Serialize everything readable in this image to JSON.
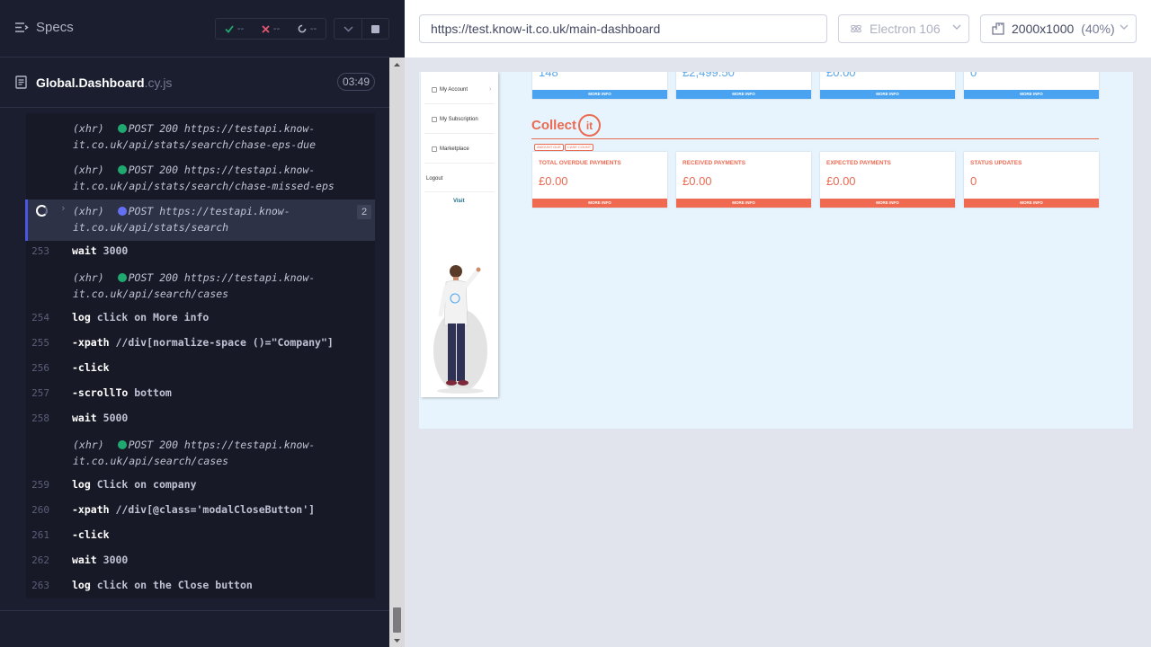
{
  "reporter": {
    "specs_label": "Specs",
    "stats": {
      "passed": "--",
      "failed": "--",
      "pending": "--"
    },
    "spec": {
      "name": "Global.Dashboard",
      "ext": ".cy.js",
      "duration": "03:49"
    },
    "commands": [
      {
        "type": "xhr",
        "tag": "(xhr)",
        "status_color": "#1fa971",
        "text": "POST 200 https://testapi.know-",
        "text2": "it.co.uk/api/stats/search/chase-eps-due"
      },
      {
        "type": "xhr",
        "tag": "(xhr)",
        "status_color": "#1fa971",
        "text": "POST 200 https://testapi.know-",
        "text2": "it.co.uk/api/stats/search/chase-missed-eps"
      },
      {
        "type": "xhr-active",
        "tag": "(xhr)",
        "status_color": "#6470f3",
        "text": "POST https://testapi.know-",
        "text2": "it.co.uk/api/stats/search",
        "count": "2"
      },
      {
        "type": "cmd",
        "num": "253",
        "name": "wait",
        "msg": "3000"
      },
      {
        "type": "xhr",
        "tag": "(xhr)",
        "status_color": "#1fa971",
        "text": "POST 200 https://testapi.know-",
        "text2": "it.co.uk/api/search/cases"
      },
      {
        "type": "cmd",
        "num": "254",
        "name": "log",
        "msg": "click on More info"
      },
      {
        "type": "cmd",
        "num": "255",
        "name": "-xpath",
        "msg": "//div[normalize-space ()=\"Company\"]"
      },
      {
        "type": "cmd",
        "num": "256",
        "name": "-click",
        "msg": ""
      },
      {
        "type": "cmd",
        "num": "257",
        "name": "-scrollTo",
        "msg": "bottom"
      },
      {
        "type": "cmd",
        "num": "258",
        "name": "wait",
        "msg": "5000"
      },
      {
        "type": "xhr",
        "tag": "(xhr)",
        "status_color": "#1fa971",
        "text": "POST 200 https://testapi.know-",
        "text2": "it.co.uk/api/search/cases"
      },
      {
        "type": "cmd",
        "num": "259",
        "name": "log",
        "msg": "Click on company"
      },
      {
        "type": "cmd",
        "num": "260",
        "name": "-xpath",
        "msg": "//div[@class='modalCloseButton']"
      },
      {
        "type": "cmd",
        "num": "261",
        "name": "-click",
        "msg": ""
      },
      {
        "type": "cmd",
        "num": "262",
        "name": "wait",
        "msg": "3000"
      },
      {
        "type": "cmd",
        "num": "263",
        "name": "log",
        "msg": "click on the Close button"
      }
    ]
  },
  "aut": {
    "url": "https://test.know-it.co.uk/main-dashboard",
    "browser": "Electron 106",
    "viewport": "2000x1000",
    "zoom": "(40%)",
    "sidebar": {
      "items": [
        "My Account",
        "My Subscription",
        "Marketplace"
      ],
      "logout": "Logout",
      "footer": "Visit"
    },
    "top_cards": [
      {
        "value": "148",
        "more": "MORE INFO"
      },
      {
        "value": "£2,499.50",
        "more": "MORE INFO"
      },
      {
        "value": "£0.00",
        "more": "MORE INFO"
      },
      {
        "value": "0",
        "more": "MORE INFO"
      }
    ],
    "collect": {
      "brand": "Collect",
      "logo": "it",
      "chips": [
        "AMOUNT DUE",
        "CASE COUNT"
      ]
    },
    "collect_cards": [
      {
        "title": "TOTAL OVERDUE PAYMENTS",
        "value": "£0.00",
        "more": "MORE INFO"
      },
      {
        "title": "RECEIVED PAYMENTS",
        "value": "£0.00",
        "more": "MORE INFO"
      },
      {
        "title": "EXPECTED PAYMENTS",
        "value": "£0.00",
        "more": "MORE INFO"
      },
      {
        "title": "STATUS UPDATES",
        "value": "0",
        "more": "MORE INFO"
      }
    ]
  }
}
